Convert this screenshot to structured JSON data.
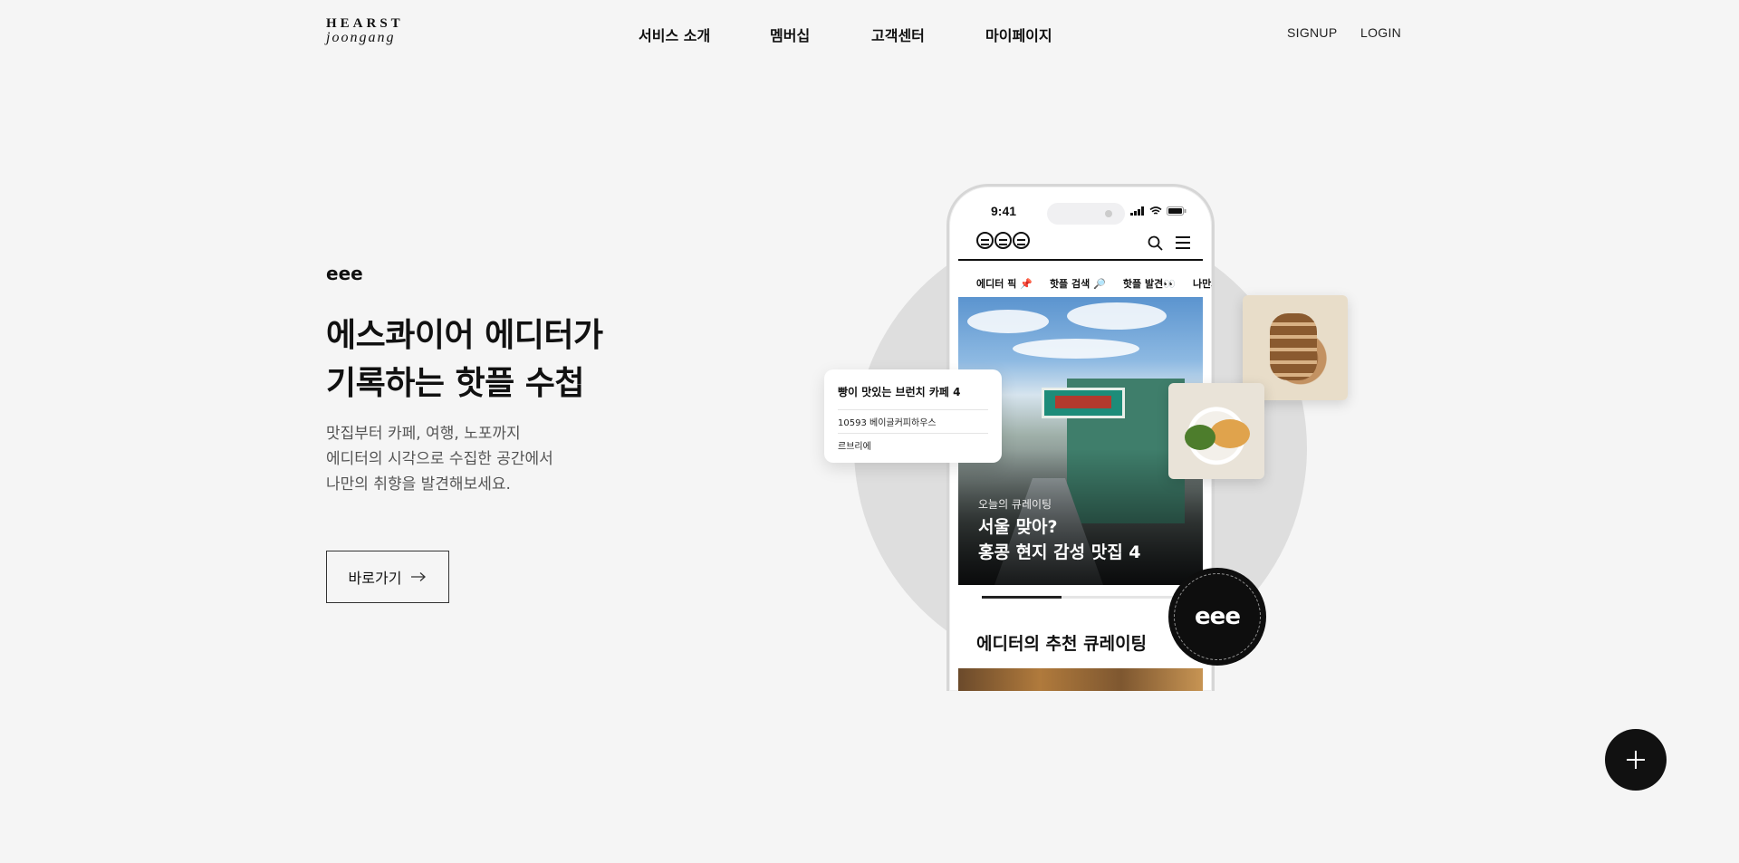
{
  "header": {
    "logo_top": "HEARST",
    "logo_bottom": "joongang",
    "nav": [
      "서비스 소개",
      "멤버십",
      "고객센터",
      "마이페이지"
    ],
    "signup": "SIGNUP",
    "login": "LOGIN"
  },
  "hero": {
    "eyebrow": "eee",
    "headline": [
      "에스콰이어 에디터가",
      "기록하는 핫플 수첩"
    ],
    "description": [
      "맛집부터 카페, 여행, 노포까지",
      "에디터의 시각으로 수집한 공간에서",
      "나만의 취향을 발견해보세요."
    ],
    "button_label": "바로가기",
    "button_icon": "arrow-right-icon"
  },
  "phone": {
    "time": "9:41",
    "tabs": [
      "에디터 픽 📌",
      "핫플 검색 🔎",
      "핫플 발견👀",
      "나만의 ·"
    ],
    "photo_kicker": "오늘의 큐레이팅",
    "photo_title": [
      "서울 맞아?",
      "홍콩 현지 감성 맛집 4"
    ],
    "progress": 0.4,
    "section_title": "에디터의 추천 큐레이팅"
  },
  "list_card": {
    "title": "빵이 맛있는 브런치 카페 4",
    "rows": [
      "10593 베이글커피하우스",
      "르브리에"
    ]
  },
  "badge": {
    "text": "eee"
  },
  "fab": {
    "icon": "plus-icon"
  },
  "colors": {
    "background": "#f5f5f5",
    "text": "#111111",
    "muted": "#555555",
    "circle": "#dedede",
    "fab": "#111111"
  }
}
